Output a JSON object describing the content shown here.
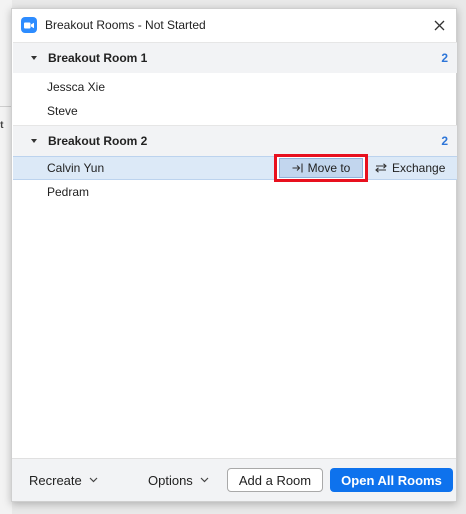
{
  "background_app": {
    "fragment_text": "nt"
  },
  "window": {
    "title": "Breakout Rooms - Not Started",
    "accent_color": "#2d8cff"
  },
  "rooms": [
    {
      "name": "Breakout Room 1",
      "count": "2",
      "members": [
        "Jessca Xie",
        "Steve"
      ]
    },
    {
      "name": "Breakout Room 2",
      "count": "2",
      "members": [
        "Calvin Yun",
        "Pedram"
      ]
    }
  ],
  "row_actions": {
    "move_to_label": "Move to",
    "exchange_label": "Exchange"
  },
  "footer": {
    "recreate_label": "Recreate",
    "options_label": "Options",
    "add_room_label": "Add a Room",
    "open_all_label": "Open All Rooms",
    "primary_color": "#0e72ed"
  },
  "annotation": {
    "highlight_color": "#e8101e"
  }
}
